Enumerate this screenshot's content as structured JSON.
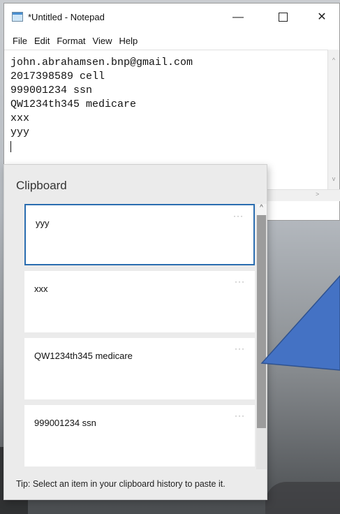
{
  "notepad": {
    "title": "*Untitled - Notepad",
    "controls": {
      "minimize": "—",
      "close": "✕"
    },
    "menu": [
      "File",
      "Edit",
      "Format",
      "View",
      "Help"
    ],
    "lines": [
      "john.abrahamsen.bnp@gmail.com",
      "2017398589 cell",
      "999001234 ssn",
      "QW1234th345 medicare",
      "xxx",
      "yyy"
    ]
  },
  "clipboard": {
    "title": "Clipboard",
    "items": [
      {
        "text": "yyy",
        "more": "···"
      },
      {
        "text": "xxx",
        "more": "···"
      },
      {
        "text": "QW1234th345 medicare",
        "more": "···"
      },
      {
        "text": "999001234 ssn",
        "more": "···"
      }
    ],
    "tip": "Tip: Select an item in your clipboard history to paste it."
  },
  "colors": {
    "accent": "#2a6db0",
    "callout": "#4472c4"
  }
}
